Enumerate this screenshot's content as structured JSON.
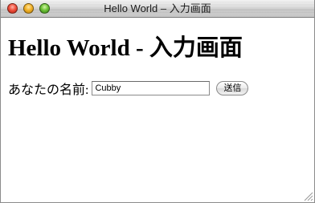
{
  "window": {
    "title": "Hello World – 入力画面"
  },
  "page": {
    "heading": "Hello World - 入力画面"
  },
  "form": {
    "name_label": "あなたの名前:",
    "name_value": "Cubby",
    "submit_label": "送信"
  },
  "colors": {
    "close": "#f0503e",
    "minimize": "#f2b32a",
    "zoom": "#6fc43a"
  }
}
